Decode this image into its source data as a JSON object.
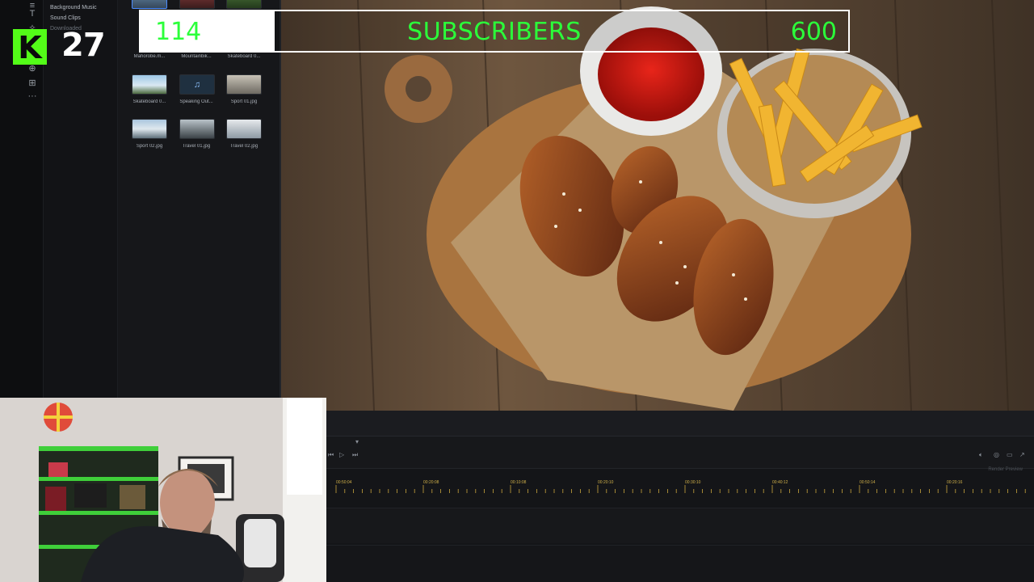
{
  "panel": {
    "categories": [
      "Background Music",
      "Sound Clips",
      "Downloaded"
    ]
  },
  "library": {
    "items": [
      {
        "label": "Mahorobe.m...",
        "kind": "video"
      },
      {
        "label": "Mountainbik...",
        "kind": "video"
      },
      {
        "label": "Skateboard 0...",
        "kind": "video"
      },
      {
        "label": "Skateboard 0...",
        "kind": "video"
      },
      {
        "label": "Speaking Out...",
        "kind": "music"
      },
      {
        "label": "Sport 01.jpg",
        "kind": "image"
      },
      {
        "label": "Sport 02.jpg",
        "kind": "image"
      },
      {
        "label": "Travel 01.jpg",
        "kind": "image"
      },
      {
        "label": "Travel 02.jpg",
        "kind": "image"
      }
    ]
  },
  "overlay": {
    "platform_letter": "K",
    "viewer_count": "27",
    "subscribers": {
      "current": "114",
      "label": "SUBSCRIBERS",
      "goal": "600",
      "progress": 0.19
    },
    "colors": {
      "accent": "#2bff3a"
    }
  },
  "timeline": {
    "ruler_ticks": [
      "00:50:04",
      "00:20:08",
      "00:10:08",
      "00:20:10",
      "00:30:10",
      "00:40:12",
      "00:50:14",
      "00:20:16"
    ],
    "preview_label": "Render Preview"
  }
}
